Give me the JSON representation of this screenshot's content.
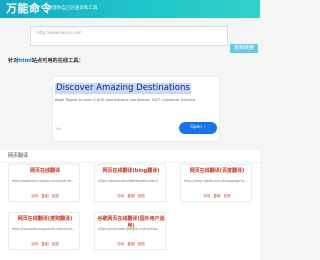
{
  "header": {
    "brand": "万能命令",
    "tagline": "创建你自己的查询和工具"
  },
  "url_bar": {
    "value": "http://www.xxxxx.com",
    "copy_label": "复制链接"
  },
  "tools_heading": {
    "prefix": "针对",
    "highlight": "html",
    "suffix": "站点可用的在线工具："
  },
  "ad": {
    "title": "Discover Amazing Destinations",
    "description": "Book flights to over 5,000 destinations worldwide, 24/7 Customer Service",
    "brand": "Trip",
    "open_label": "Open",
    "open_arrow": "›"
  },
  "section": {
    "title": "网页翻译"
  },
  "cards": [
    {
      "title": "网页在线翻译",
      "url": "http://webtrans.yodao.com/webTra...",
      "actions": [
        "访问",
        "复制",
        "反馈"
      ]
    },
    {
      "title": "网页在线翻译(bing翻译)",
      "url": "https://www.translatetheweb.com/?...",
      "actions": [
        "访问",
        "复制",
        "反馈"
      ]
    },
    {
      "title": "网页在线翻译(百度翻译)",
      "url": "http://fanyi.baidu.com/transpage?q...",
      "actions": [
        "访问",
        "复制",
        "反馈"
      ]
    },
    {
      "title": "网页在线翻译(搜狗翻译)",
      "url": "http://translate.sogoucdn.com/pcvt...",
      "actions": [
        "访问",
        "复制",
        "反馈"
      ]
    },
    {
      "title": "谷歌网页在线翻译(国外用户适用)",
      "url": "https://translate.google.cn/translat...",
      "actions": [
        "访问",
        "复制",
        "反馈"
      ]
    }
  ]
}
